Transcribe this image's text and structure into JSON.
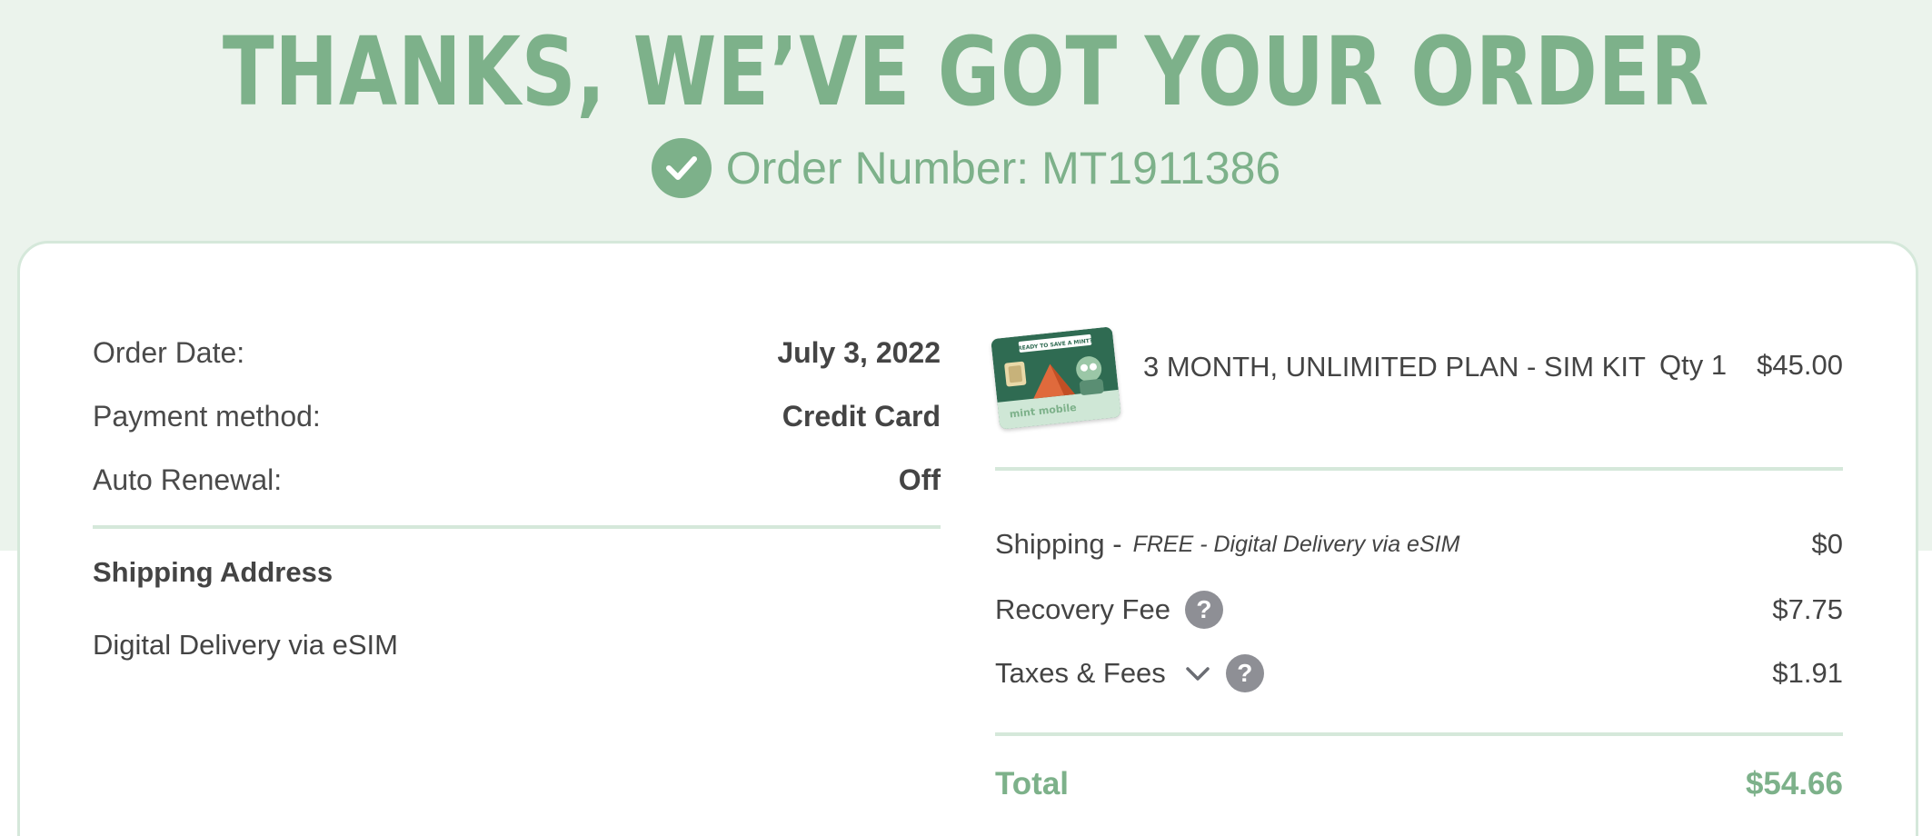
{
  "header": {
    "headline": "THANKS, WE’VE GOT YOUR ORDER",
    "order_number": "Order Number: MT1911386"
  },
  "order_info": {
    "date_label": "Order Date:",
    "date_value": "July 3, 2022",
    "payment_label": "Payment method:",
    "payment_value": "Credit Card",
    "renewal_label": "Auto Renewal:",
    "renewal_value": "Off"
  },
  "shipping_address": {
    "heading": "Shipping Address",
    "value": "Digital Delivery via eSIM"
  },
  "product": {
    "name": "3 MONTH, UNLIMITED PLAN - SIM KIT",
    "qty": "Qty 1",
    "price": "$45.00",
    "image_banner_text": "READY TO SAVE A MINT?",
    "image_brand_text": "mint mobile"
  },
  "summary": {
    "shipping_label": "Shipping -",
    "shipping_note": "FREE - Digital Delivery via eSIM",
    "shipping_value": "$0",
    "recovery_label": "Recovery Fee",
    "recovery_value": "$7.75",
    "taxes_label": "Taxes & Fees",
    "taxes_value": "$1.91",
    "help_glyph": "?",
    "total_label": "Total",
    "total_value": "$54.66"
  },
  "colors": {
    "accent": "#7db18a",
    "band": "#ebf3ec",
    "divider": "#d5e8da",
    "help_icon": "#8e8f95"
  },
  "icons": {
    "order_check": "check-circle-icon",
    "help": "help-icon",
    "expand": "chevron-down-icon"
  }
}
